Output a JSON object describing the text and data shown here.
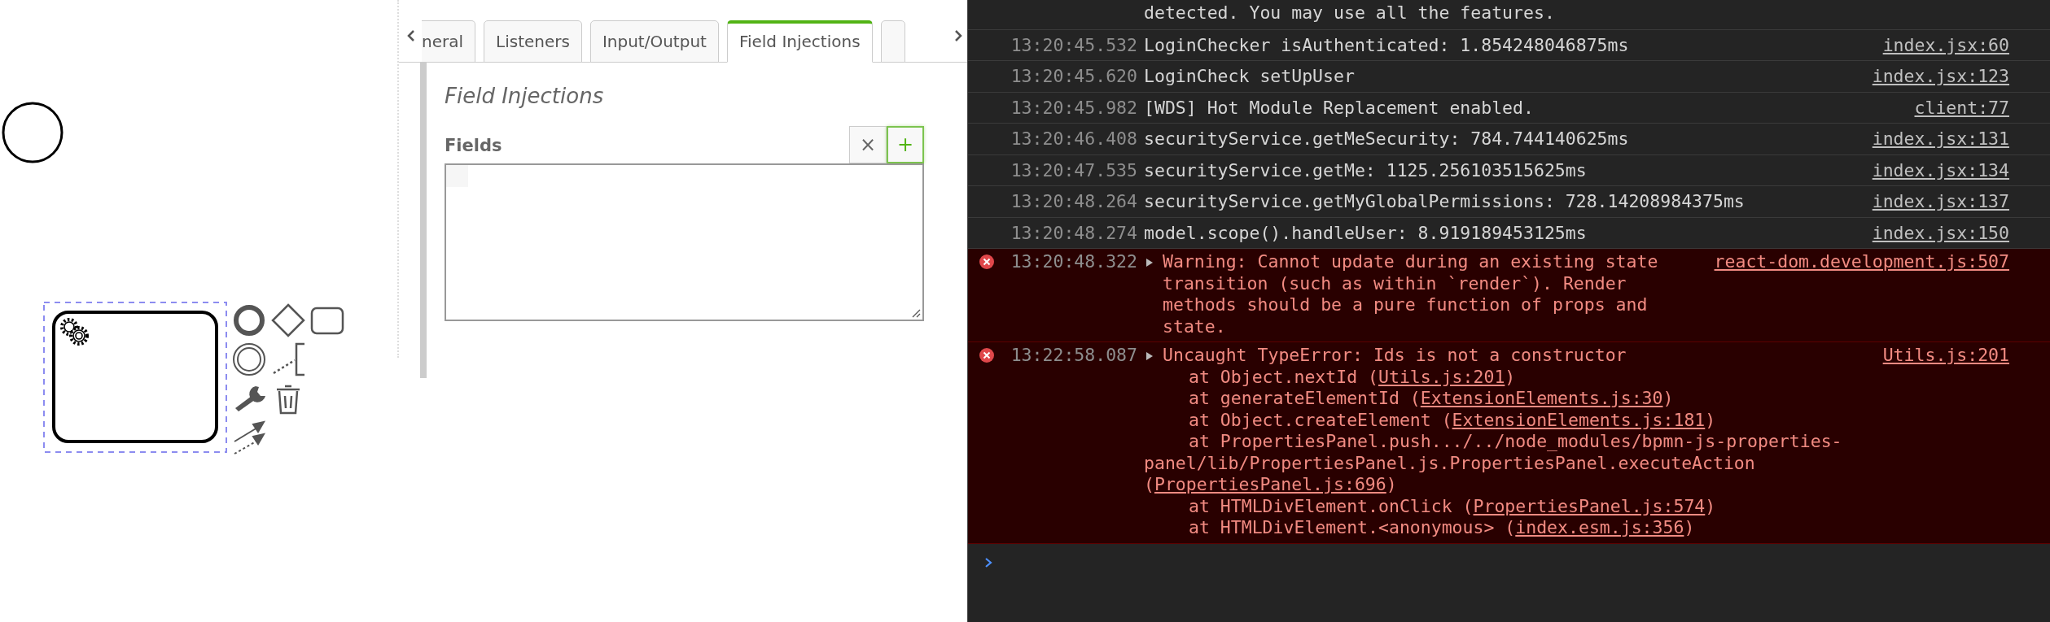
{
  "canvas": {
    "task": {
      "selected": true
    }
  },
  "properties": {
    "tabs": [
      {
        "label": "neral",
        "selected": false
      },
      {
        "label": "Listeners",
        "selected": false
      },
      {
        "label": "Input/Output",
        "selected": false
      },
      {
        "label": "Field Injections",
        "selected": true
      },
      {
        "selected": false
      }
    ],
    "section_title": "Field Injections",
    "fields": {
      "label": "Fields",
      "remove_button": "×",
      "add_button": "+"
    }
  },
  "console": {
    "messages": [
      {
        "kind": "log",
        "text": "detected. You may use all the features."
      },
      {
        "kind": "log",
        "time": "13:20:45.532",
        "text": "LoginChecker isAuthenticated: 1.854248046875ms",
        "source": "index.jsx:60"
      },
      {
        "kind": "log",
        "time": "13:20:45.620",
        "text": "LoginCheck setUpUser",
        "source": "index.jsx:123"
      },
      {
        "kind": "log",
        "time": "13:20:45.982",
        "text": "[WDS] Hot Module Replacement enabled.",
        "source": "client:77"
      },
      {
        "kind": "log",
        "time": "13:20:46.408",
        "text": "securityService.getMeSecurity: 784.744140625ms",
        "source": "index.jsx:131"
      },
      {
        "kind": "log",
        "time": "13:20:47.535",
        "text": "securityService.getMe: 1125.256103515625ms",
        "source": "index.jsx:134"
      },
      {
        "kind": "log",
        "time": "13:20:48.264",
        "text": "securityService.getMyGlobalPermissions: 728.14208984375ms",
        "source": "index.jsx:137"
      },
      {
        "kind": "log",
        "time": "13:20:48.274",
        "text": "model.scope().handleUser: 8.919189453125ms",
        "source": "index.jsx:150"
      },
      {
        "kind": "error",
        "time": "13:20:48.322",
        "text": "Warning: Cannot update during an existing state transition (such as within `render`). Render methods should be a pure function of props and state.",
        "source": "react-dom.development.js:507"
      },
      {
        "kind": "error",
        "time": "13:22:58.087",
        "text": "Uncaught TypeError: Ids is not a constructor",
        "source": "Utils.js:201",
        "stack": [
          {
            "text": "at Object.nextId (",
            "link": "Utils.js:201",
            "end": ")"
          },
          {
            "text": "at generateElementId (",
            "link": "ExtensionElements.js:30",
            "end": ")"
          },
          {
            "text": "at Object.createElement (",
            "link": "ExtensionElements.js:181",
            "end": ")"
          },
          {
            "text": "at PropertiesPanel.push.../../node_modules/bpmn-js-properties-panel/lib/PropertiesPanel.js.PropertiesPanel.executeAction (",
            "link": "PropertiesPanel.js:696",
            "end": ")"
          },
          {
            "text": "at HTMLDivElement.onClick (",
            "link": "PropertiesPanel.js:574",
            "end": ")"
          },
          {
            "text": "at HTMLDivElement.<anonymous> (",
            "link": "index.esm.js:356",
            "end": ")"
          }
        ]
      }
    ]
  }
}
